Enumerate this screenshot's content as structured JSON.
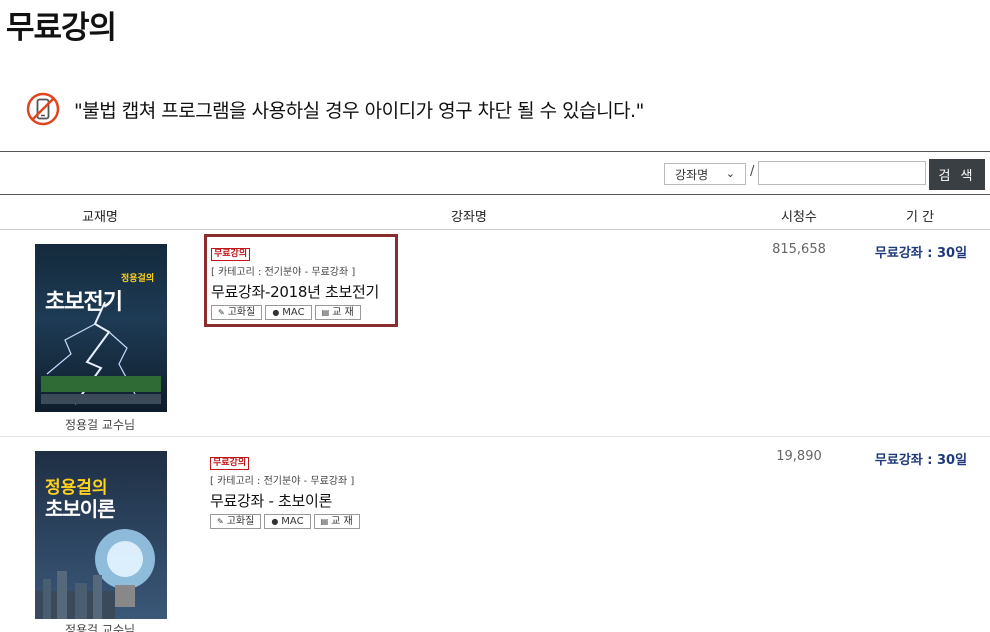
{
  "page": {
    "title": "무료강의"
  },
  "notice": {
    "icon": "no-phone-icon",
    "text": "\"불법 캡쳐 프로그램을 사용하실 경우 아이디가 영구 차단 될 수 있습니다.\""
  },
  "search": {
    "select_value": "강좌명",
    "separator": "/",
    "input_value": "",
    "button_label": "검 색"
  },
  "table": {
    "headers": {
      "book": "교재명",
      "course": "강좌명",
      "views": "시청수",
      "period": "기 간"
    },
    "rows": [
      {
        "book_title_lines": [
          "정용걸의",
          "초보전기"
        ],
        "instructor": "정용걸 교수님",
        "badge": "무료강의",
        "category": "[ 카테고리 : 전기분야 - 무료강좌 ]",
        "course_title": "무료강좌-2018년 초보전기",
        "chips": [
          "고화질",
          "MAC",
          "교 재"
        ],
        "views": "815,658",
        "period": "무료강좌 : 30일"
      },
      {
        "book_title_lines": [
          "정용걸의",
          "초보이론"
        ],
        "instructor": "정용걸 교수님",
        "badge": "무료강의",
        "category": "[ 카테고리 : 전기분야 - 무료강좌 ]",
        "course_title": "무료강좌 - 초보이론",
        "chips": [
          "고화질",
          "MAC",
          "교 재"
        ],
        "views": "19,890",
        "period": "무료강좌 : 30일"
      }
    ]
  },
  "colors": {
    "highlight_border": "#8a2d2d",
    "badge_red": "#c0161a",
    "period_blue": "#1f3a7a",
    "search_button": "#3a3f44"
  }
}
